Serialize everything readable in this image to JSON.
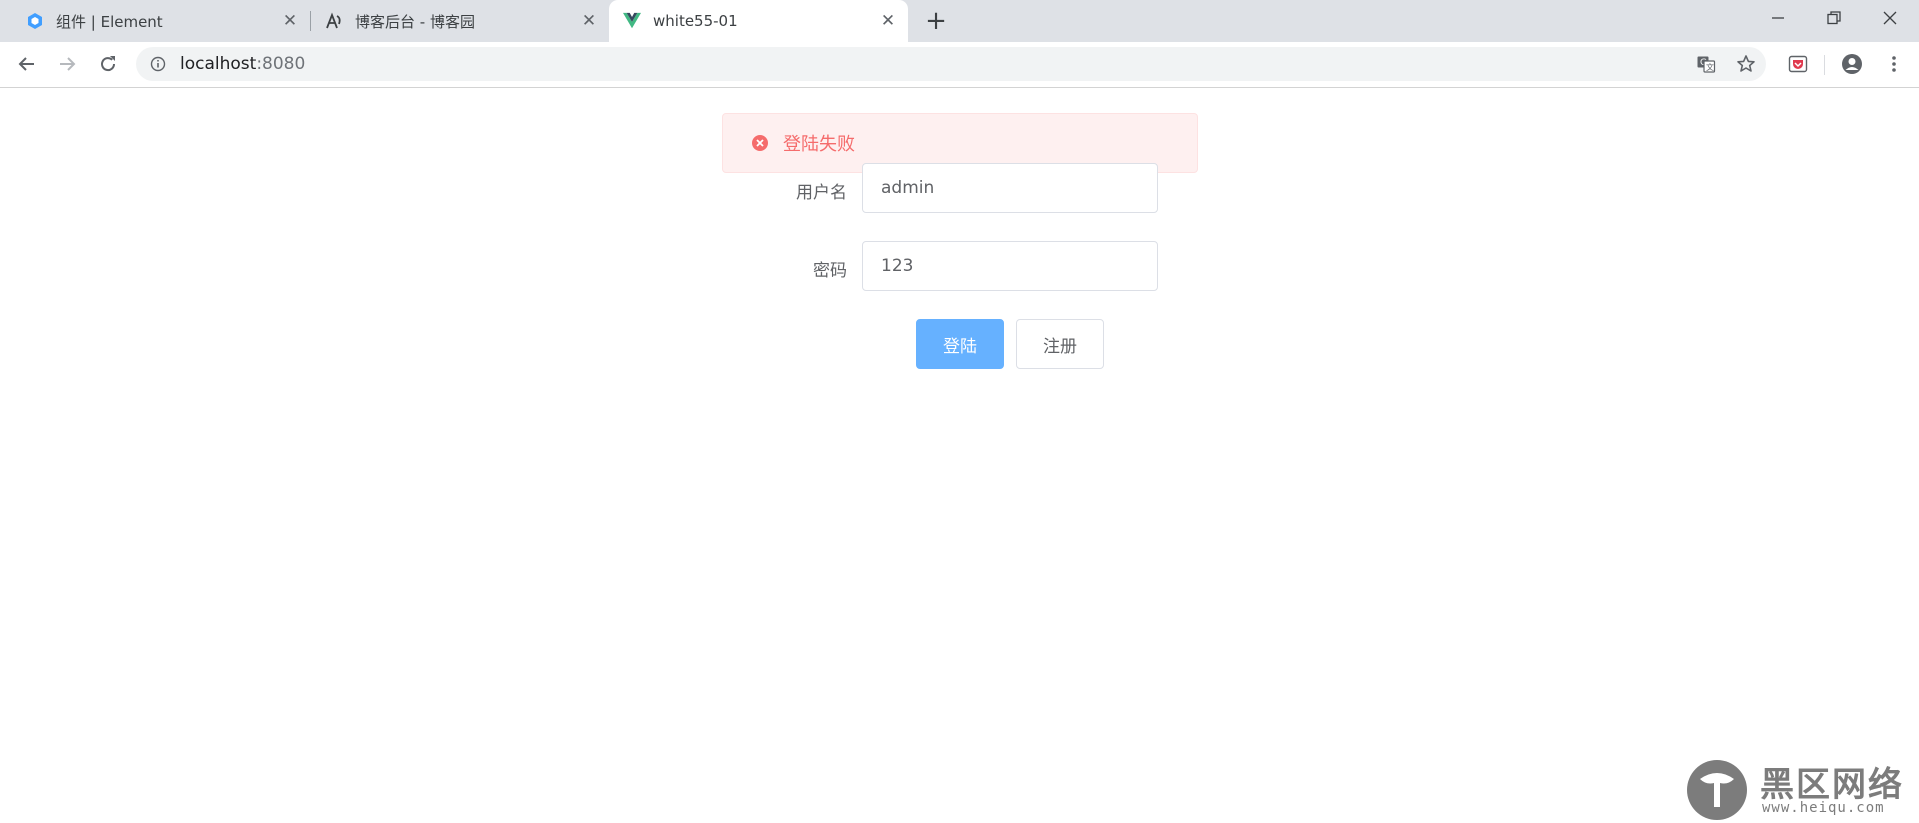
{
  "browser": {
    "tabs": [
      {
        "title": "组件 | Element",
        "favicon": "element-logo-icon",
        "active": false
      },
      {
        "title": "博客后台 - 博客园",
        "favicon": "cnblogs-logo-icon",
        "active": false
      },
      {
        "title": "white55-01",
        "favicon": "vue-logo-icon",
        "active": true
      }
    ],
    "address": {
      "host": "localhost",
      "port": ":8080"
    }
  },
  "alert": {
    "message": "登陆失败",
    "type": "error",
    "color": "#f56c6c"
  },
  "form": {
    "username_label": "用户名",
    "username_value": "admin",
    "password_label": "密码",
    "password_value": "123",
    "login_button": "登陆",
    "register_button": "注册"
  },
  "watermark": {
    "text": "黑区网络",
    "url": "www.heiqu.com"
  },
  "colors": {
    "primary": "#66b1ff",
    "danger": "#f56c6c",
    "danger_bg": "#fef0f0"
  }
}
